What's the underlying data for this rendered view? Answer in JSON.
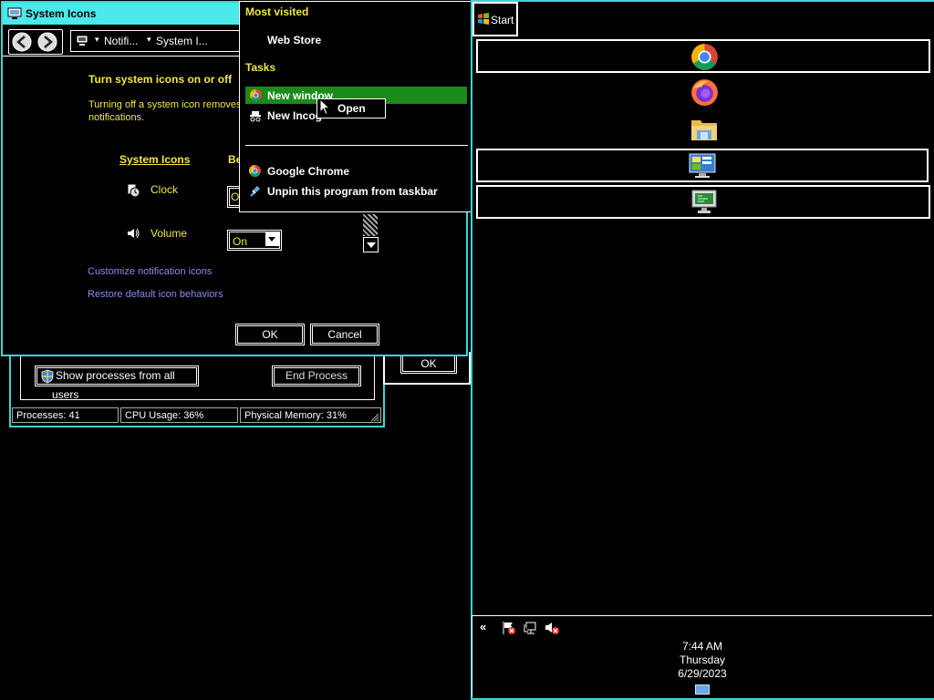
{
  "system_icons_window": {
    "title": "System Icons",
    "breadcrumb": [
      "Notifi...",
      "System I..."
    ],
    "heading": "Turn system icons on or off",
    "description_line1": "Turning off a system icon removes t",
    "description_line2": "notifications.",
    "col_system_icons": "System Icons",
    "col_behaviors": "Be",
    "icons": [
      {
        "name": "Clock",
        "value": "O"
      },
      {
        "name": "Volume",
        "value": "On"
      }
    ],
    "link_customize": "Customize notification icons",
    "link_restore": "Restore default icon behaviors",
    "ok_label": "OK",
    "cancel_label": "Cancel"
  },
  "task_manager": {
    "show_processes_label": "Show processes from all users",
    "end_process_label": "End Process",
    "ok_label": "OK",
    "status": {
      "processes": "Processes: 41",
      "cpu": "CPU Usage: 36%",
      "memory": "Physical Memory: 31%"
    }
  },
  "jump_list": {
    "section_most_visited": "Most visited",
    "item_web_store": "Web Store",
    "section_tasks": "Tasks",
    "item_new_window": "New window",
    "item_new_incognito": "New Incog",
    "tooltip_open": "Open",
    "item_google_chrome": "Google Chrome",
    "item_unpin": "Unpin this program from taskbar"
  },
  "taskbar": {
    "start_label": "Start",
    "buttons": [
      "chrome-icon",
      "firefox-icon",
      "file-explorer-icon",
      "control-panel-icon",
      "remote-desktop-icon"
    ],
    "tray_chevron": "«",
    "clock_time": "7:44 AM",
    "clock_day": "Thursday",
    "clock_date": "6/29/2023"
  },
  "colors": {
    "accent": "#3ed3d3",
    "highlight": "#1a8a1a",
    "label_yellow": "#f1e64a",
    "link_blue": "#8a8af0"
  }
}
